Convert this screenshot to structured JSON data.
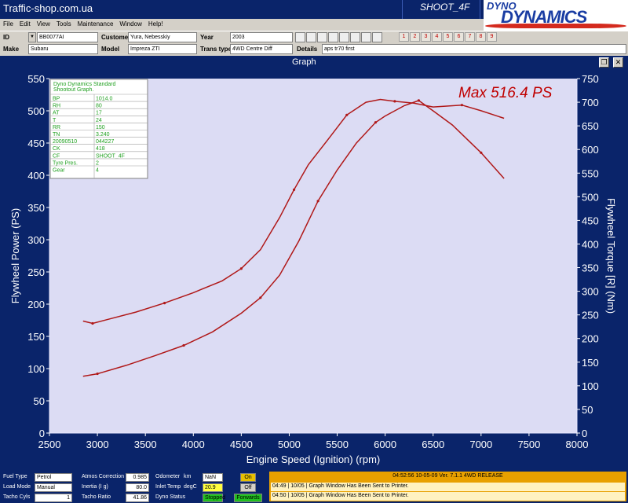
{
  "app": {
    "title": "Traffic-shop.com.ua",
    "shoot_label": "SHOOT_4F",
    "logo_top": "DYNO",
    "logo_bottom": "DYNAMICS"
  },
  "menu": [
    "File",
    "Edit",
    "View",
    "Tools",
    "Maintenance",
    "Window",
    "Help!"
  ],
  "info": {
    "id_label": "ID",
    "id_value": "BB0077AI",
    "customer_label": "Customer",
    "customer_value": "Yura, Nebesskiy",
    "year_label": "Year",
    "year_value": "2003",
    "make_label": "Make",
    "make_value": "Subaru",
    "model_label": "Model",
    "model_value": "Impreza ZTI",
    "transtype_label": "Trans type",
    "transtype_value": "4WD Centre Diff",
    "details_label": "Details",
    "details_value": "aps tr70 first"
  },
  "run_buttons": [
    "1",
    "2",
    "3",
    "4",
    "5",
    "6",
    "7",
    "8",
    "9"
  ],
  "graph_window": {
    "title": "Graph"
  },
  "chart_data": {
    "type": "line",
    "max_label": "Max 516.4 PS",
    "xlabel": "Engine Speed (Ignition) (rpm)",
    "ylabel_left": "Flywheel Power (PS)",
    "ylabel_right": "Flywheel Torque [R] (Nm)",
    "xlim": [
      2500,
      8000
    ],
    "ylim_left": [
      0,
      550
    ],
    "ylim_right": [
      0,
      750
    ],
    "x_ticks": [
      2500,
      3000,
      3500,
      4000,
      4500,
      5000,
      5500,
      6000,
      6500,
      7000,
      7500,
      8000
    ],
    "y_ticks_left": [
      0,
      50,
      100,
      150,
      200,
      250,
      300,
      350,
      400,
      450,
      500,
      550
    ],
    "y_ticks_right": [
      0,
      50,
      100,
      150,
      200,
      250,
      300,
      350,
      400,
      450,
      500,
      550,
      600,
      650,
      700,
      750
    ],
    "series": [
      {
        "axis": "left",
        "color": "#b01818",
        "x": [
          2850,
          3000,
          3300,
          3600,
          3900,
          4200,
          4500,
          4700,
          4900,
          5100,
          5300,
          5500,
          5700,
          5900,
          6000,
          6200,
          6350,
          6500,
          6700,
          7000,
          7240
        ],
        "y": [
          88,
          92,
          105,
          120,
          136,
          157,
          186,
          210,
          245,
          298,
          360,
          408,
          450,
          482,
          492,
          508,
          516,
          500,
          478,
          435,
          395
        ]
      },
      {
        "axis": "right",
        "color": "#b01818",
        "x": [
          2850,
          2950,
          3100,
          3400,
          3700,
          4000,
          4300,
          4500,
          4700,
          4900,
          5050,
          5200,
          5400,
          5600,
          5800,
          5950,
          6100,
          6300,
          6500,
          6800,
          7000,
          7240
        ],
        "y": [
          237,
          232,
          240,
          256,
          275,
          297,
          322,
          348,
          388,
          456,
          515,
          568,
          620,
          673,
          700,
          706,
          702,
          698,
          690,
          694,
          682,
          666
        ]
      }
    ],
    "info_table": {
      "title": "Dyno Dynamics Standard Shootout Graph.",
      "rows": [
        [
          "BP",
          "1014.0"
        ],
        [
          "RH",
          "80"
        ],
        [
          "AT",
          "17"
        ],
        [
          "T",
          "24"
        ],
        [
          "RR",
          "150"
        ],
        [
          "TN",
          "3.240"
        ],
        [
          "20090510",
          "044227"
        ],
        [
          "CK",
          "418"
        ],
        [
          "CF",
          "SHOOT_4F"
        ],
        [
          "Tyre Pres.",
          "2"
        ],
        [
          "Gear",
          "4"
        ]
      ]
    }
  },
  "status": {
    "fuel_type_label": "Fuel Type",
    "fuel_type_value": "Petrol",
    "load_mode_label": "Load Mode",
    "load_mode_value": "Manual",
    "tacho_cyls_label": "Tacho Cyls",
    "tacho_cyls_value": "1",
    "atmos_corr_label": "Atmos Correction",
    "atmos_corr_value": "0.985",
    "inertia_label": "Inertia (I g)",
    "inertia_value": "80.0",
    "tacho_ratio_label": "Tacho Ratio",
    "tacho_ratio_value": "41.86",
    "odometer_label": "Odometer",
    "odometer_unit": "km",
    "odometer_value": "NaN",
    "inlet_temp_label": "Inlet Temp",
    "inlet_temp_unit": "degC",
    "inlet_temp_value": "20.9",
    "dyno_status_label": "Dyno Status",
    "dyno_status_value": "Stopped",
    "on_label": "On",
    "off_label": "Off",
    "forwards_label": "Forwards",
    "log_header": "04:52:56    10-05-09    Ver.  7.1.1  4WD  RELEASE",
    "log_lines": [
      "04:49 | 10/05 | Graph Window Has Been Sent to Printer.",
      "04:50 | 10/05 | Graph Window Has Been Sent to Printer."
    ]
  }
}
